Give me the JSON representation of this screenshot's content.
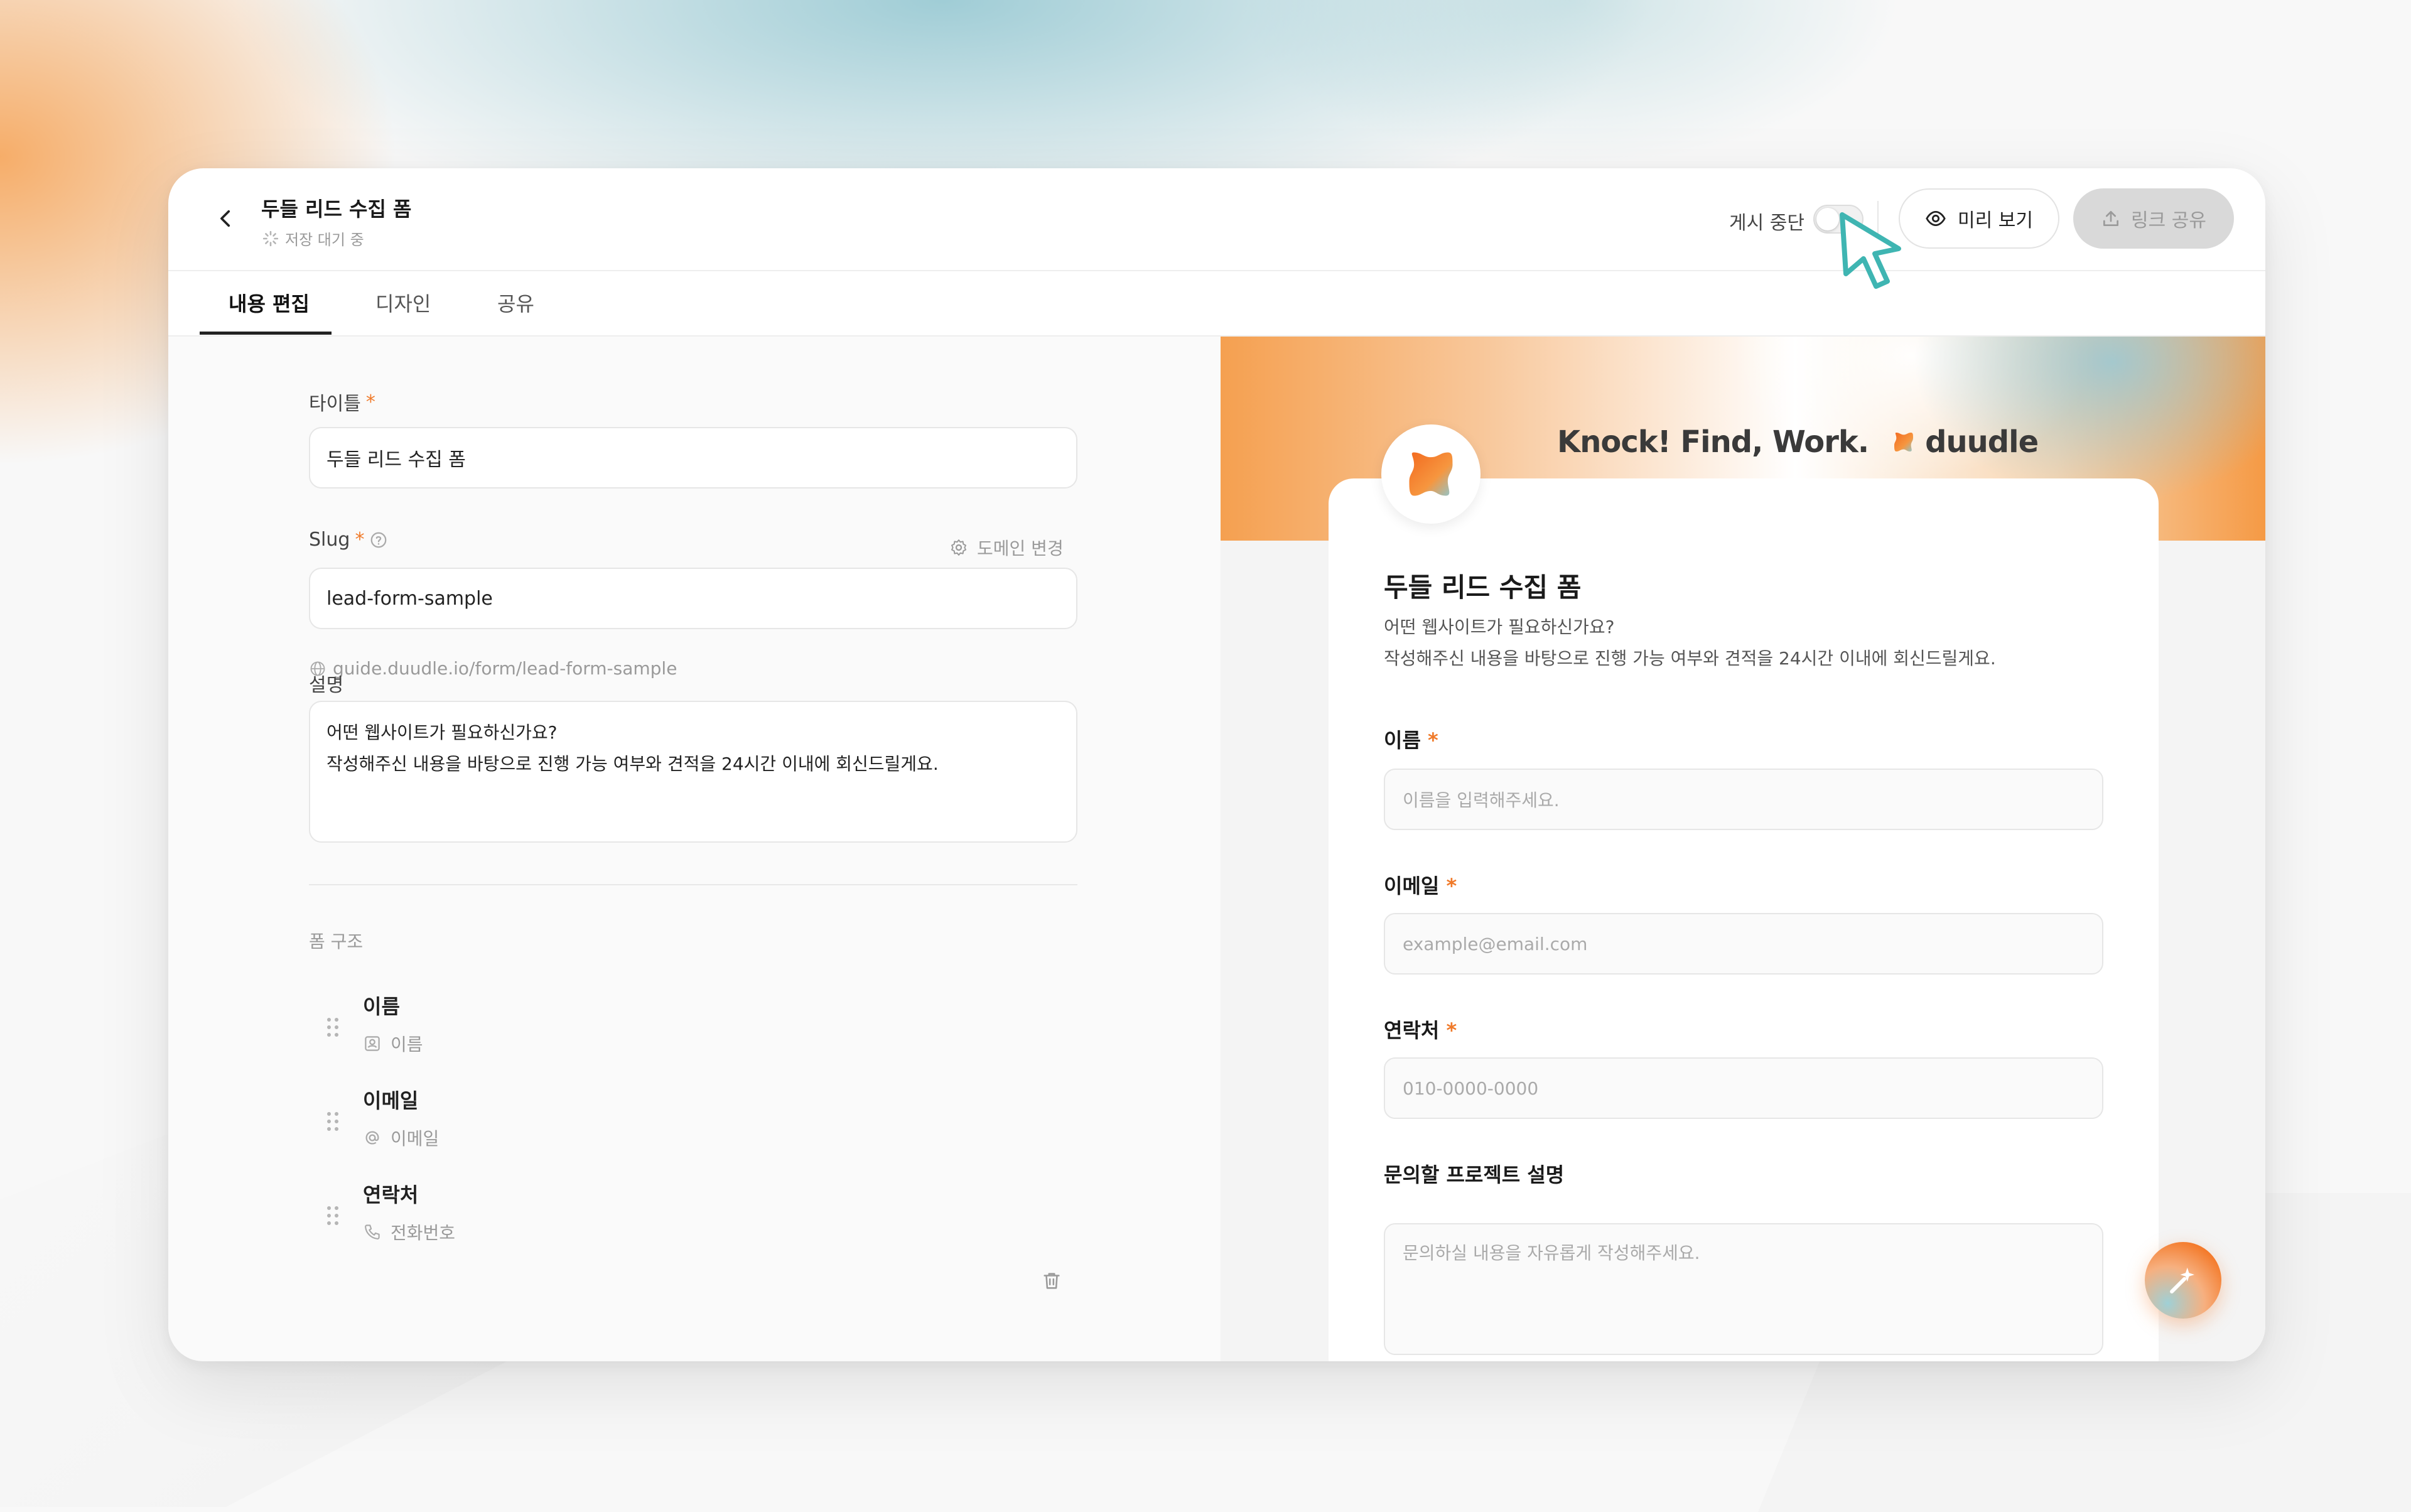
{
  "header": {
    "title": "두들 리드 수집 폼",
    "save_status": "저장 대기 중",
    "publish_toggle_label": "게시 중단",
    "preview_button": "미리 보기",
    "share_button": "링크 공유"
  },
  "tabs": [
    "내용 편집",
    "디자인",
    "공유"
  ],
  "editor": {
    "title_label": "타이틀",
    "title_value": "두들 리드 수집 폼",
    "slug_label": "Slug",
    "domain_change": "도메인 변경",
    "slug_value": "lead-form-sample",
    "url_hint": "guide.duudle.io/form/lead-form-sample",
    "description_label": "설명",
    "description_line1": "어떤 웹사이트가 필요하신가요?",
    "description_line2": "작성해주신 내용을 바탕으로 진행 가능 여부와 견적을 24시간 이내에 회신드릴게요.",
    "structure_title": "폼 구조",
    "structure_items": [
      {
        "name": "이름",
        "type": "이름"
      },
      {
        "name": "이메일",
        "type": "이메일"
      },
      {
        "name": "연락처",
        "type": "전화번호"
      }
    ]
  },
  "preview": {
    "tagline": "Knock! Find, Work.",
    "brand": "duudle",
    "form_title": "두들 리드 수집 폼",
    "desc_line1": "어떤 웹사이트가 필요하신가요?",
    "desc_line2": "작성해주신 내용을 바탕으로 진행 가능 여부와 견적을 24시간 이내에 회신드릴게요.",
    "fields": [
      {
        "label": "이름",
        "required": "*",
        "placeholder": "이름을 입력해주세요."
      },
      {
        "label": "이메일",
        "required": "*",
        "placeholder": "example@email.com"
      },
      {
        "label": "연락처",
        "required": "*",
        "placeholder": "010-0000-0000"
      },
      {
        "label": "문의할 프로젝트 설명",
        "required": "",
        "placeholder": "문의하실 내용을 자유롭게 작성해주세요."
      }
    ]
  },
  "colors": {
    "accent": "#f07a2a",
    "brand_blue": "#9fd0d6"
  }
}
